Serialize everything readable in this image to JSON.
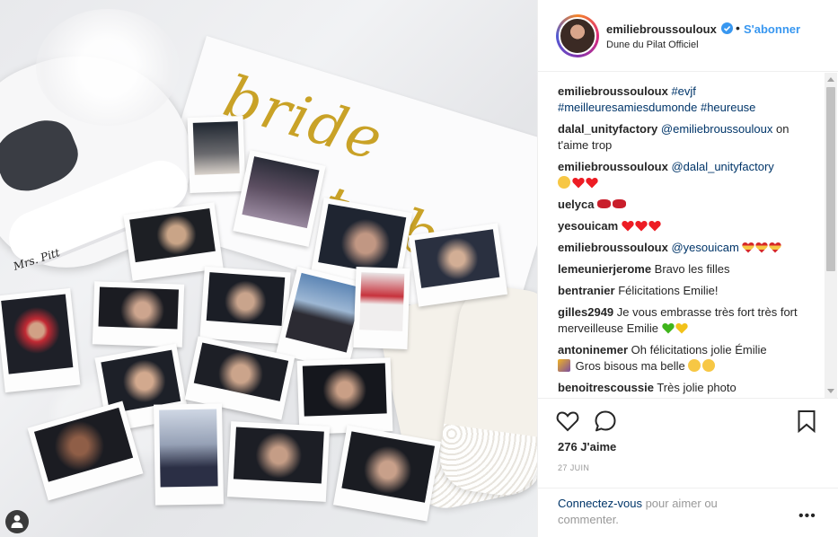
{
  "post": {
    "username": "emiliebroussouloux",
    "follow_label": "S'abonner",
    "separator": "•",
    "location": "Dune du Pilat Officiel",
    "photo_sash_text": [
      "bride",
      "to be"
    ],
    "shoe_text": "Mrs. Pitt"
  },
  "comments": [
    {
      "user": "emiliebroussouloux",
      "tags": "#evjf #meilleuresamiesdumonde #heureuse"
    },
    {
      "user": "dalal_unityfactory",
      "mention": "@emiliebroussouloux",
      "text": "on t'aime trop"
    },
    {
      "user": "emiliebroussouloux",
      "mention": "@dalal_unityfactory",
      "emoji": [
        "face-with-tears-emoji",
        "red-heart-emoji",
        "red-heart-emoji"
      ]
    },
    {
      "user": "uelyca",
      "emoji": [
        "lips-emoji",
        "lips-emoji"
      ]
    },
    {
      "user": "yesouicam",
      "emoji": [
        "red-heart-emoji",
        "red-heart-emoji",
        "red-heart-emoji"
      ]
    },
    {
      "user": "emiliebroussouloux",
      "mention": "@yesouicam",
      "emoji": [
        "spain-heart-emoji",
        "spain-heart-emoji",
        "spain-heart-emoji"
      ]
    },
    {
      "user": "lemeunierjerome",
      "text": "Bravo les filles"
    },
    {
      "user": "bentranier",
      "text": "Félicitations Emilie!"
    },
    {
      "user": "gilles2949",
      "text": "Je vous embrasse très fort très fort merveilleuse Emilie",
      "emoji": [
        "green-heart-emoji",
        "yellow-heart-emoji"
      ]
    },
    {
      "user": "antoninemer",
      "text": "Oh félicitations jolie Émilie",
      "text2": "Gros bisous ma belle",
      "emoji": [
        "party-popper-emoji",
        "kiss-face-emoji",
        "kiss-face-emoji"
      ]
    },
    {
      "user": "benoitrescoussie",
      "text": "Très jolie photo"
    }
  ],
  "actions": {
    "likes": "276 J'aime",
    "date": "27 JUIN"
  },
  "login": {
    "link": "Connectez-vous",
    "text": " pour aimer ou commenter."
  },
  "more_label": "•••",
  "colors": {
    "link_blue": "#3897f0",
    "mention_blue": "#003569",
    "heart_red": "#ed1c24",
    "border": "#efefef"
  }
}
